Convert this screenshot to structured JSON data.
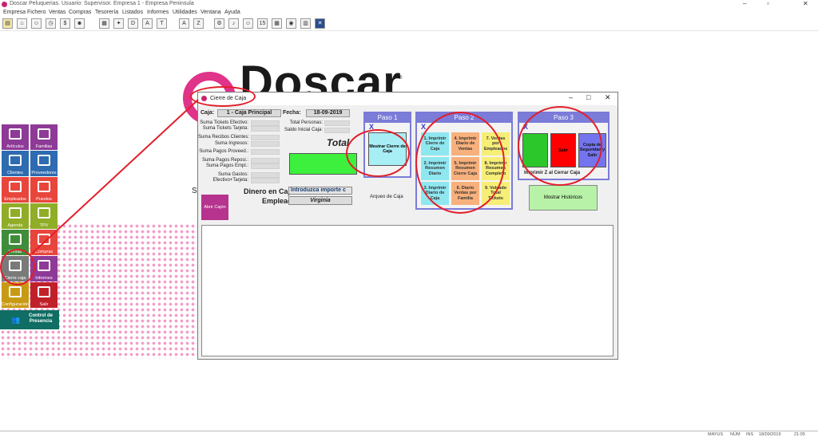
{
  "window": {
    "title": "Doscar Peluquerias. Usuario: Supervisor. Empresa 1 - Empresa Peninsula",
    "minimize": "–",
    "restore": "▫",
    "close": "✕"
  },
  "menu": [
    "Empresa",
    "Fichero",
    "Ventas",
    "Compras",
    "Tesorería",
    "Listados",
    "Informes",
    "Utilidades",
    "Ventana",
    "Ayuda"
  ],
  "toolbar_icons": [
    "folder",
    "home",
    "people",
    "clock",
    "money",
    "people2",
    "calendar",
    "star",
    "calendar2",
    "cart",
    "gear",
    "people3",
    "grid",
    "list",
    "tool"
  ],
  "logo": {
    "text": "Doscar",
    "registered": "®",
    "tagline_fragment": "So"
  },
  "tiles": [
    {
      "label": "Artículos",
      "color": "#8e3a97"
    },
    {
      "label": "Familias",
      "color": "#8e3a97"
    },
    {
      "label": "Clientes",
      "color": "#2e6bb0"
    },
    {
      "label": "Proveedores",
      "color": "#2e6bb0"
    },
    {
      "label": "Empleados",
      "color": "#e8463c"
    },
    {
      "label": "Puestos",
      "color": "#e8463c"
    },
    {
      "label": "Agenda",
      "color": "#8fad27"
    },
    {
      "label": "TPV",
      "color": "#8fad27"
    },
    {
      "label": "Ventas",
      "color": "#3f8d3a"
    },
    {
      "label": "Compras",
      "color": "#e8463c"
    },
    {
      "label": "Cierre caja",
      "color": "#7a7a7a"
    },
    {
      "label": "Informes",
      "color": "#8e3a97"
    },
    {
      "label": "Configuración",
      "color": "#c89a14"
    },
    {
      "label": "Salir",
      "color": "#c0202a"
    }
  ],
  "control_presencia": "Control de Presencia",
  "dialog": {
    "title": "Cierre de Caja",
    "minimize": "–",
    "maximize": "□",
    "close": "✕",
    "caja_label": "Caja:",
    "caja_value": "1 - Caja Principal",
    "fecha_label": "Fecha:",
    "fecha_value": "18-09-2019",
    "left_labels": [
      "Suma Tickets Efectivo:",
      "Suma Tickets Tarjeta:",
      "Suma Recibos Clientes:",
      "Suma Ingresos:",
      "Suma Pagos Proveed.:",
      "Suma Pagos Reposi.:",
      "Suma Pagos Empl.:",
      "Suma Gastos:",
      "Efectivo+Tarjeta:"
    ],
    "total_personas": "Total Personas:",
    "saldo_inicial": "Saldo Inicial Caja:",
    "total": "Total",
    "dinero_label": "Dinero en Cajón:",
    "dinero_value": "Introduzca importe c",
    "empleado_label": "Empleado:",
    "empleado_value": "Virginia",
    "abrir_cajon": "Abrir Cajón",
    "arqueo": "Arqueo de Caja",
    "paso1": {
      "header": "Paso 1",
      "marker": "X",
      "button": "Mostrar Cierre de Caja"
    },
    "paso2": {
      "header": "Paso 2",
      "marker": "X",
      "buttons": [
        {
          "label": "1. Imprimir Cierre de Caja",
          "color": "#8fe7f0"
        },
        {
          "label": "4. Imprimir Diario de Ventas",
          "color": "#f8b07c"
        },
        {
          "label": "7. Ventas por Empleados",
          "color": "#f7ee77"
        },
        {
          "label": "2. Imprimir Resumen Diario",
          "color": "#8fe7f0"
        },
        {
          "label": "5. Imprimir Resumen Cierre Caja",
          "color": "#f8b07c"
        },
        {
          "label": "8. Imprimir Resumen Completo",
          "color": "#f7ee77"
        },
        {
          "label": "3. Imprimir Diario de Caja",
          "color": "#8fe7f0"
        },
        {
          "label": "6. Diario Ventas por Familia",
          "color": "#f8b07c"
        },
        {
          "label": "9. Volcado Total Tickets",
          "color": "#f7ee77"
        }
      ]
    },
    "paso3": {
      "header": "Paso 3",
      "marker": "X",
      "btn_green": "",
      "btn_red": "Salir",
      "btn_blue": "Copia de Seguridad y Salir",
      "imprimir_z": "Imprimir Z al Cerrar Caja",
      "mostrar_historicos": "Mostrar Históricos"
    }
  },
  "statusbar": [
    "MAYUS",
    "NÚM",
    "INS",
    "18/09/2019",
    "21:05"
  ]
}
